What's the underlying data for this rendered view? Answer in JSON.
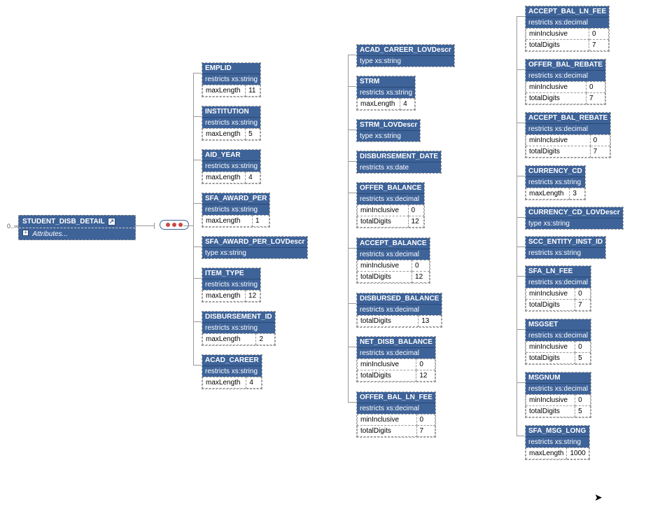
{
  "root": {
    "title": "STUDENT_DISB_DETAIL",
    "attributes_label": "Attributes...",
    "cardinality": "0..∞"
  },
  "col1": [
    {
      "name": "EMPLID",
      "sub": "restricts xs:string",
      "facets": [
        [
          "maxLength",
          "11"
        ]
      ]
    },
    {
      "name": "INSTITUTION",
      "sub": "restricts xs:string",
      "facets": [
        [
          "maxLength",
          "5"
        ]
      ]
    },
    {
      "name": "AID_YEAR",
      "sub": "restricts xs:string",
      "facets": [
        [
          "maxLength",
          "4"
        ]
      ]
    },
    {
      "name": "SFA_AWARD_PER",
      "sub": "restricts xs:string",
      "facets": [
        [
          "maxLength",
          "1"
        ]
      ]
    },
    {
      "name": "SFA_AWARD_PER_LOVDescr",
      "sub": "type xs:string",
      "facets": []
    },
    {
      "name": "ITEM_TYPE",
      "sub": "restricts xs:string",
      "facets": [
        [
          "maxLength",
          "12"
        ]
      ]
    },
    {
      "name": "DISBURSEMENT_ID",
      "sub": "restricts xs:string",
      "facets": [
        [
          "maxLength",
          "2"
        ]
      ]
    },
    {
      "name": "ACAD_CAREER",
      "sub": "restricts xs:string",
      "facets": [
        [
          "maxLength",
          "4"
        ]
      ]
    }
  ],
  "col2": [
    {
      "name": "ACAD_CAREER_LOVDescr",
      "sub": "type xs:string",
      "facets": []
    },
    {
      "name": "STRM",
      "sub": "restricts xs:string",
      "facets": [
        [
          "maxLength",
          "4"
        ]
      ]
    },
    {
      "name": "STRM_LOVDescr",
      "sub": "type xs:string",
      "facets": []
    },
    {
      "name": "DISBURSEMENT_DATE",
      "sub": "restricts xs:date",
      "facets": []
    },
    {
      "name": "OFFER_BALANCE",
      "sub": "restricts xs:decimal",
      "facets": [
        [
          "minInclusive",
          "0"
        ],
        [
          "totalDigits",
          "12"
        ]
      ]
    },
    {
      "name": "ACCEPT_BALANCE",
      "sub": "restricts xs:decimal",
      "facets": [
        [
          "minInclusive",
          "0"
        ],
        [
          "totalDigits",
          "12"
        ]
      ]
    },
    {
      "name": "DISBURSED_BALANCE",
      "sub": "restricts xs:decimal",
      "facets": [
        [
          "totalDigits",
          "13"
        ]
      ]
    },
    {
      "name": "NET_DISB_BALANCE",
      "sub": "restricts xs:decimal",
      "facets": [
        [
          "minInclusive",
          "0"
        ],
        [
          "totalDigits",
          "12"
        ]
      ]
    },
    {
      "name": "OFFER_BAL_LN_FEE",
      "sub": "restricts xs:decimal",
      "facets": [
        [
          "minInclusive",
          "0"
        ],
        [
          "totalDigits",
          "7"
        ]
      ]
    }
  ],
  "col3": [
    {
      "name": "ACCEPT_BAL_LN_FEE",
      "sub": "restricts xs:decimal",
      "facets": [
        [
          "minInclusive",
          "0"
        ],
        [
          "totalDigits",
          "7"
        ]
      ]
    },
    {
      "name": "OFFER_BAL_REBATE",
      "sub": "restricts xs:decimal",
      "facets": [
        [
          "minInclusive",
          "0"
        ],
        [
          "totalDigits",
          "7"
        ]
      ]
    },
    {
      "name": "ACCEPT_BAL_REBATE",
      "sub": "restricts xs:decimal",
      "facets": [
        [
          "minInclusive",
          "0"
        ],
        [
          "totalDigits",
          "7"
        ]
      ]
    },
    {
      "name": "CURRENCY_CD",
      "sub": "restricts xs:string",
      "facets": [
        [
          "maxLength",
          "3"
        ]
      ]
    },
    {
      "name": "CURRENCY_CD_LOVDescr",
      "sub": "type xs:string",
      "facets": []
    },
    {
      "name": "SCC_ENTITY_INST_ID",
      "sub": "restricts xs:string",
      "facets": []
    },
    {
      "name": "SFA_LN_FEE",
      "sub": "restricts xs:decimal",
      "facets": [
        [
          "minInclusive",
          "0"
        ],
        [
          "totalDigits",
          "7"
        ]
      ]
    },
    {
      "name": "MSGSET",
      "sub": "restricts xs:decimal",
      "facets": [
        [
          "minInclusive",
          "0"
        ],
        [
          "totalDigits",
          "5"
        ]
      ]
    },
    {
      "name": "MSGNUM",
      "sub": "restricts xs:decimal",
      "facets": [
        [
          "minInclusive",
          "0"
        ],
        [
          "totalDigits",
          "5"
        ]
      ]
    },
    {
      "name": "SFA_MSG_LONG",
      "sub": "restricts xs:string",
      "facets": [
        [
          "maxLength",
          "1000"
        ]
      ]
    }
  ]
}
